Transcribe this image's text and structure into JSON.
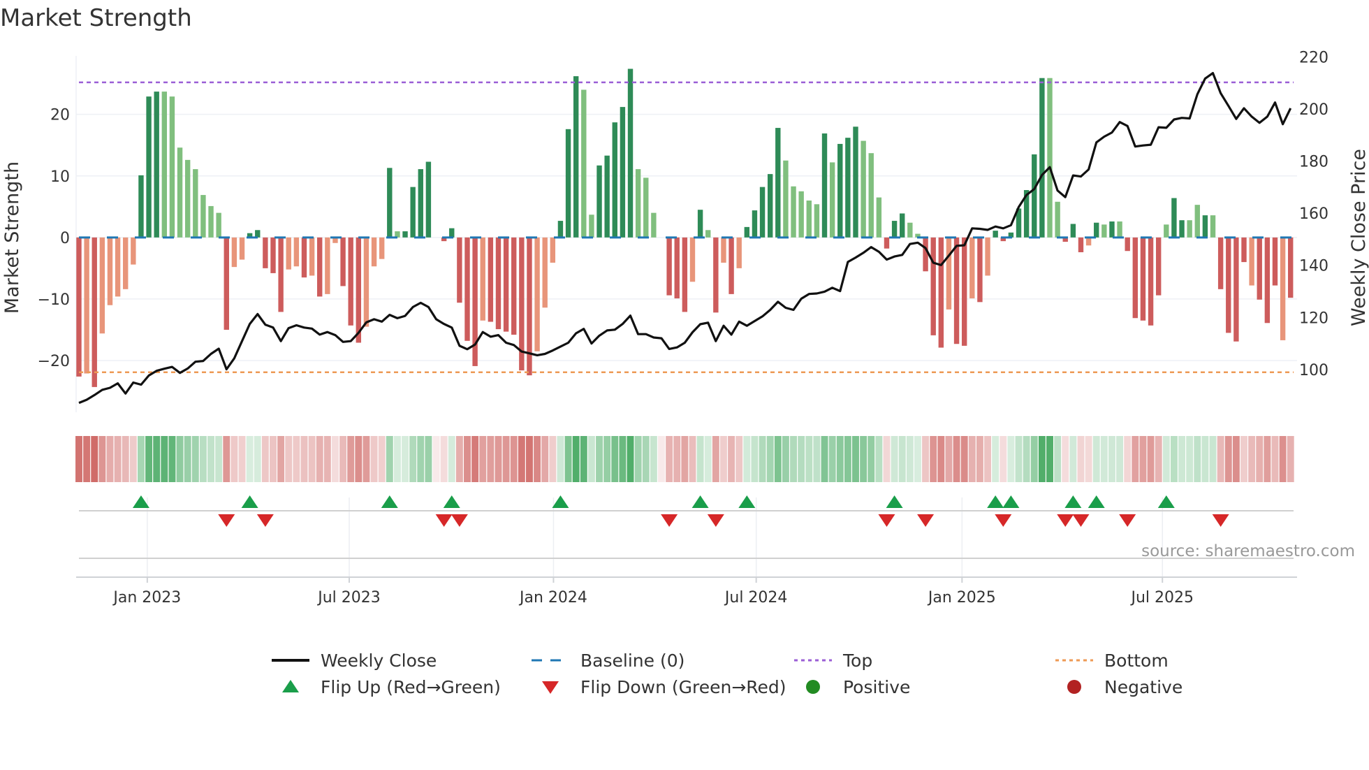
{
  "title": "Market Strength",
  "source": "source: sharemaestro.com",
  "chart_data": {
    "type": "bar",
    "title": "Market Strength",
    "ylabel": "Market Strength",
    "y2label": "Weekly Close Price",
    "ylim": [
      -28.4,
      29.5
    ],
    "y2lim": [
      83.6,
      220.4
    ],
    "yticks": [
      {
        "v": 20,
        "label": "20"
      },
      {
        "v": 10,
        "label": "10"
      },
      {
        "v": 0,
        "label": "0"
      },
      {
        "v": -10,
        "label": "−10"
      },
      {
        "v": -20,
        "label": "−20"
      }
    ],
    "y2ticks": [
      {
        "v": 100,
        "label": "100"
      },
      {
        "v": 120,
        "label": "120"
      },
      {
        "v": 140,
        "label": "140"
      },
      {
        "v": 160,
        "label": "160"
      },
      {
        "v": 180,
        "label": "180"
      },
      {
        "v": 200,
        "label": "200"
      },
      {
        "v": 220,
        "label": "220"
      }
    ],
    "xticks": [
      {
        "week": 9.8,
        "label": "Jan 2023"
      },
      {
        "week": 35.8,
        "label": "Jul 2023"
      },
      {
        "week": 62.1,
        "label": "Jan 2024"
      },
      {
        "week": 88.2,
        "label": "Jul 2024"
      },
      {
        "week": 114.7,
        "label": "Jan 2025"
      },
      {
        "week": 140.5,
        "label": "Jul 2025"
      }
    ],
    "top": 25.2,
    "bottom": -21.9,
    "baseline": 0,
    "values": [
      -22.6,
      -22.1,
      -24.3,
      -15.6,
      -11,
      -9.6,
      -8.4,
      -4.4,
      10.1,
      22.9,
      23.7,
      23.7,
      22.9,
      14.6,
      12.6,
      11.1,
      6.9,
      5.1,
      4.0,
      -15,
      -4.8,
      -3.6,
      0.7,
      1.2,
      -5,
      -5.8,
      -12.1,
      -5.2,
      -4.7,
      -6.5,
      -6.2,
      -9.6,
      -9.2,
      -0.9,
      -7.9,
      -14.3,
      -17.1,
      -14.5,
      -4.7,
      -3.5,
      11.3,
      1.0,
      1.0,
      8.2,
      11.1,
      12.3,
      0,
      -0.6,
      1.5,
      -10.6,
      -16.8,
      -20.9,
      -13.5,
      -13.7,
      -14.9,
      -15.3,
      -15.8,
      -21.6,
      -22.4,
      -18.5,
      -11.4,
      -4.1,
      2.7,
      17.6,
      26.2,
      24.0,
      3.7,
      11.7,
      13.3,
      18.7,
      21.2,
      27.4,
      11.1,
      9.7,
      4.0,
      0,
      -9.4,
      -9.9,
      -12.1,
      -7.2,
      4.5,
      1.2,
      -12.2,
      -4.1,
      -9.2,
      -5.0,
      1.7,
      4.4,
      8.2,
      10.3,
      17.8,
      12.5,
      8.3,
      7.5,
      6.0,
      5.4,
      16.9,
      12.2,
      15.2,
      16.2,
      18.0,
      15.7,
      13.7,
      6.5,
      -1.8,
      2.7,
      3.9,
      2.4,
      0.6,
      -5.5,
      -15.9,
      -17.9,
      -11.7,
      -17.3,
      -17.6,
      -9.9,
      -10.5,
      -6.2,
      1.1,
      -0.6,
      0.8,
      4.7,
      7.7,
      13.5,
      25.9,
      25.9,
      5.8,
      -0.7,
      2.2,
      -2.4,
      -1.3,
      2.4,
      2.1,
      2.6,
      2.6,
      -2.2,
      -13.1,
      -13.5,
      -14.3,
      -9.4,
      2.1,
      6.4,
      2.8,
      2.8,
      5.3,
      3.6,
      3.6,
      -8.4,
      -15.5,
      -16.9,
      -4.0,
      -7.8,
      -10.1,
      -13.9,
      -7.8,
      -16.7,
      -9.8
    ],
    "tones": "DLDLLLLLDDDLLLLLLLLDLLDDDDDLLDLDLLDDDLLLDLDDDDDDDDDDLDDDDDDLLLDDDLLDDDDDLLLDDDDLDLDLDLDDDDDLLLLLDLDDDLLLDDDLLDDDLDDLDLDDDDDDDLLDDDLDLDLDDDDDLDDLLDLDDDDLDDDLDL",
    "closes": [
      87.2,
      88.4,
      90.2,
      92.2,
      93.0,
      94.7,
      90.8,
      95.0,
      94.2,
      97.7,
      99.5,
      100.3,
      101.0,
      98.7,
      100.4,
      103.0,
      103.3,
      106.0,
      108.0,
      100.1,
      104.3,
      110.9,
      117.5,
      121.3,
      117.2,
      116.1,
      110.9,
      115.9,
      117.0,
      116.1,
      115.7,
      113.4,
      114.4,
      113.2,
      110.6,
      110.9,
      114.1,
      118.1,
      119.3,
      118.4,
      121.0,
      119.7,
      120.6,
      124.0,
      125.6,
      124.0,
      119.3,
      117.5,
      116.1,
      109.1,
      107.8,
      109.6,
      114.4,
      112.6,
      113.2,
      110.3,
      109.4,
      106.9,
      106.2,
      105.5,
      106.0,
      107.3,
      108.8,
      110.3,
      113.9,
      115.6,
      110.0,
      113.0,
      115.0,
      115.3,
      117.5,
      120.7,
      113.6,
      113.6,
      112.3,
      112.0,
      107.9,
      108.5,
      110.3,
      114.3,
      117.4,
      118.0,
      110.9,
      116.8,
      113.4,
      118.4,
      116.8,
      118.6,
      120.4,
      122.9,
      126.0,
      123.7,
      122.9,
      127.2,
      129.0,
      129.2,
      129.9,
      131.4,
      130.1,
      141.3,
      143.0,
      144.8,
      147.0,
      145.2,
      142.2,
      143.4,
      144.0,
      148.2,
      148.7,
      146.6,
      141.0,
      140.1,
      143.7,
      147.5,
      147.7,
      154.2,
      154.0,
      153.6,
      154.9,
      154.2,
      155.4,
      162.4,
      167.0,
      169.3,
      174.7,
      177.7,
      168.7,
      166.2,
      174.5,
      174.1,
      176.8,
      187.2,
      189.4,
      191.0,
      195.0,
      193.5,
      185.6,
      186.0,
      186.3,
      193.0,
      192.8,
      196.0,
      196.6,
      196.4,
      205.7,
      211.7,
      213.8,
      206.1,
      201.2,
      196.2,
      200.3,
      197.1,
      194.7,
      197.1,
      202.5,
      194.2,
      200.3
    ],
    "colors": {
      "dark_green": "#2e8b57",
      "light_green": "#80bf7e",
      "dark_red": "#cd5c5c",
      "light_red": "#e8957a",
      "baseline": "#1f77b4",
      "top": "#9b5fd6",
      "bottom": "#ee9a55",
      "close": "#111111",
      "flip_up": "#1a9e4a",
      "flip_down": "#d62728",
      "positive": "#228b22",
      "negative": "#b22222"
    },
    "legend": {
      "placement": "bottom",
      "weekly_close": "Weekly Close",
      "baseline": "Baseline (0)",
      "top": "Top",
      "bottom": "Bottom",
      "flip_up": "Flip Up (Red→Green)",
      "flip_down": "Flip Down (Green→Red)",
      "positive": "Positive",
      "negative": "Negative"
    }
  }
}
